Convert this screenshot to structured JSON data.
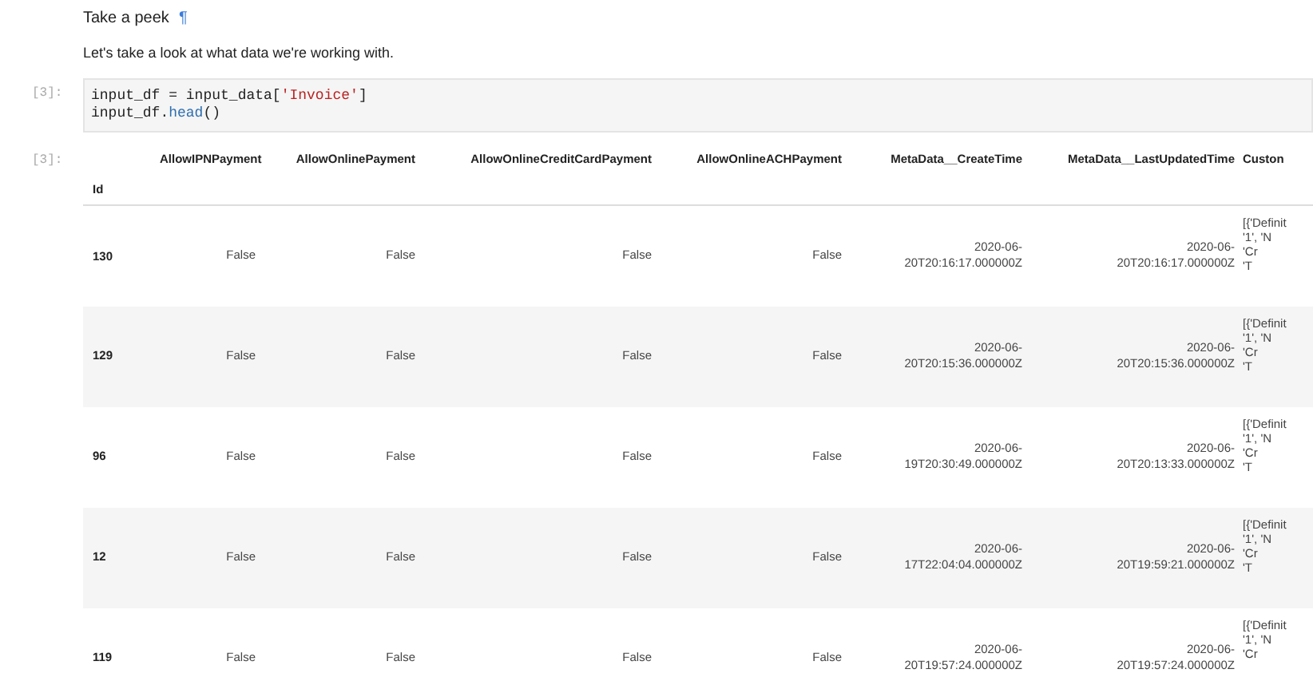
{
  "markdown": {
    "heading": "Take a peek",
    "anchor": "¶",
    "paragraph": "Let's take a look at what data we're working with."
  },
  "input_cell": {
    "prompt": "[3]:",
    "lines": [
      [
        {
          "text": "input_df = input_data[",
          "kind": "plain"
        },
        {
          "text": "'Invoice'",
          "kind": "string"
        },
        {
          "text": "]",
          "kind": "plain"
        }
      ],
      [
        {
          "text": "input_df.",
          "kind": "plain"
        },
        {
          "text": "head",
          "kind": "method"
        },
        {
          "text": "()",
          "kind": "plain"
        }
      ]
    ]
  },
  "output_cell": {
    "prompt": "[3]:",
    "table": {
      "index_name": "Id",
      "columns": [
        "AllowIPNPayment",
        "AllowOnlinePayment",
        "AllowOnlineCreditCardPayment",
        "AllowOnlineACHPayment",
        "MetaData__CreateTime",
        "MetaData__LastUpdatedTime",
        "Custon"
      ],
      "rows": [
        {
          "index": "130",
          "cells": [
            [
              "False"
            ],
            [
              "False"
            ],
            [
              "False"
            ],
            [
              "False"
            ],
            [
              "2020-06-",
              "20T20:16:17.000000Z"
            ],
            [
              "2020-06-",
              "20T20:16:17.000000Z"
            ],
            [
              "[{'Definit",
              "'1', 'N",
              "'Cr",
              "'T"
            ]
          ]
        },
        {
          "index": "129",
          "cells": [
            [
              "False"
            ],
            [
              "False"
            ],
            [
              "False"
            ],
            [
              "False"
            ],
            [
              "2020-06-",
              "20T20:15:36.000000Z"
            ],
            [
              "2020-06-",
              "20T20:15:36.000000Z"
            ],
            [
              "[{'Definit",
              "'1', 'N",
              "'Cr",
              "'T"
            ]
          ]
        },
        {
          "index": "96",
          "cells": [
            [
              "False"
            ],
            [
              "False"
            ],
            [
              "False"
            ],
            [
              "False"
            ],
            [
              "2020-06-",
              "19T20:30:49.000000Z"
            ],
            [
              "2020-06-",
              "20T20:13:33.000000Z"
            ],
            [
              "[{'Definit",
              "'1', 'N",
              "'Cr",
              "'T"
            ]
          ]
        },
        {
          "index": "12",
          "cells": [
            [
              "False"
            ],
            [
              "False"
            ],
            [
              "False"
            ],
            [
              "False"
            ],
            [
              "2020-06-",
              "17T22:04:04.000000Z"
            ],
            [
              "2020-06-",
              "20T19:59:21.000000Z"
            ],
            [
              "[{'Definit",
              "'1', 'N",
              "'Cr",
              "'T"
            ]
          ]
        },
        {
          "index": "119",
          "cells": [
            [
              "False"
            ],
            [
              "False"
            ],
            [
              "False"
            ],
            [
              "False"
            ],
            [
              "2020-06-",
              "20T19:57:24.000000Z"
            ],
            [
              "2020-06-",
              "20T19:57:24.000000Z"
            ],
            [
              "[{'Definit",
              "'1', 'N",
              "'Cr"
            ]
          ]
        }
      ]
    }
  }
}
